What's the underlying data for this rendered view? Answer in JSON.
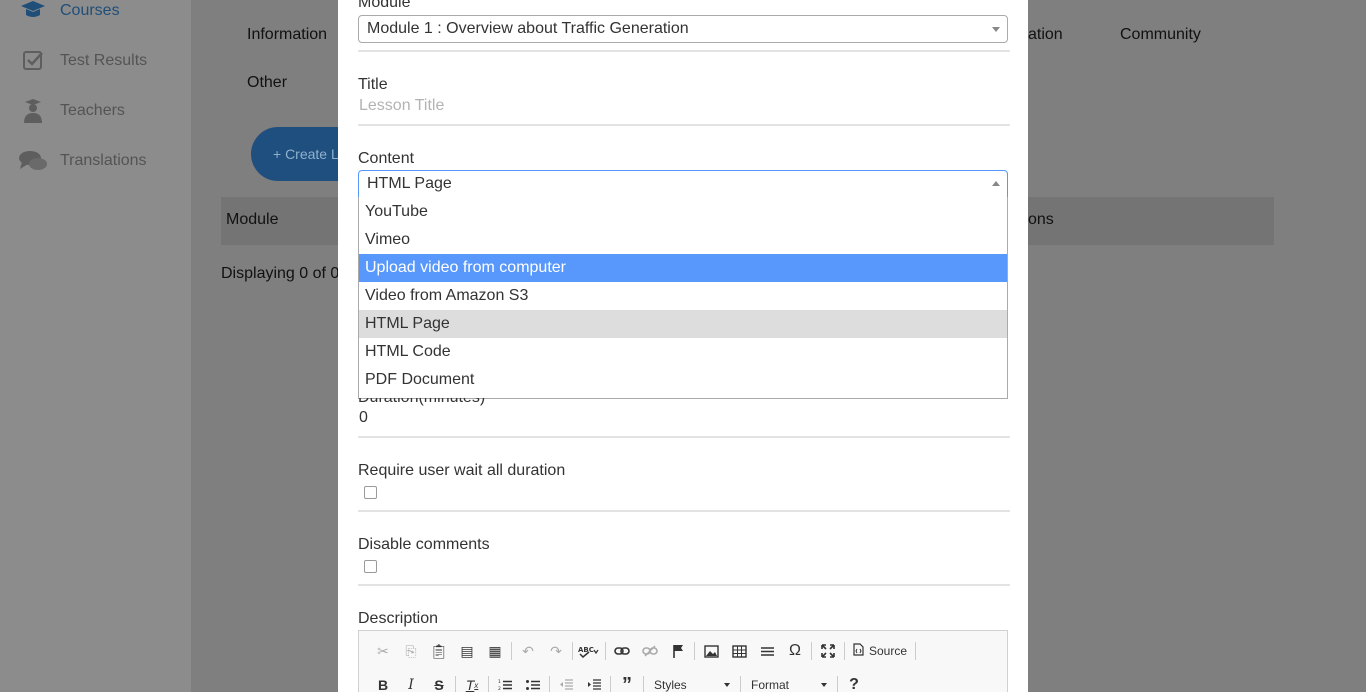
{
  "sidebar": {
    "items": [
      {
        "label": "Courses",
        "icon": "graduation-cap-icon"
      },
      {
        "label": "Test Results",
        "icon": "checkbox-icon"
      },
      {
        "label": "Teachers",
        "icon": "teacher-icon"
      },
      {
        "label": "Translations",
        "icon": "chat-bubbles-icon"
      }
    ]
  },
  "background": {
    "tabs": [
      "Information",
      "ation",
      "Community",
      "Other"
    ],
    "create_button": "+ Create L",
    "table_header": {
      "module": "Module",
      "actions": "ons"
    },
    "displaying": "Displaying 0 of 0"
  },
  "modal": {
    "module": {
      "label": "Module",
      "selected": "Module 1 : Overview about Traffic Generation"
    },
    "title": {
      "label": "Title",
      "placeholder": "Lesson Title"
    },
    "content": {
      "label": "Content",
      "selected": "HTML Page",
      "options": [
        "YouTube",
        "Vimeo",
        "Upload video from computer",
        "Video from Amazon S3",
        "HTML Page",
        "HTML Code",
        "PDF Document"
      ],
      "highlighted_index": 2,
      "selected_index": 4
    },
    "duration": {
      "label": "Duration(minutes)",
      "value": "0"
    },
    "require_wait": {
      "label": "Require user wait all duration",
      "checked": false
    },
    "disable_comments": {
      "label": "Disable comments",
      "checked": false
    },
    "description": {
      "label": "Description",
      "toolbar": {
        "source_label": "Source",
        "styles_label": "Styles",
        "format_label": "Format"
      }
    }
  }
}
